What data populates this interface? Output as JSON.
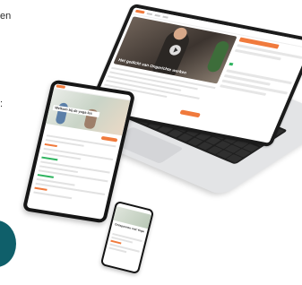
{
  "side_text": {
    "fragment_top": "en",
    "fragment_mid": ":"
  },
  "laptop": {
    "video_title": "Het gedicht van Ongerichte werken"
  },
  "tablet": {
    "hero_title": "Welkom bij de yoga-les"
  },
  "phone": {
    "hero_title": "Ontspannen met Yoga"
  },
  "colors": {
    "accent": "#f07a3c",
    "success": "#2fb35f",
    "teal": "#0f5f6a"
  }
}
